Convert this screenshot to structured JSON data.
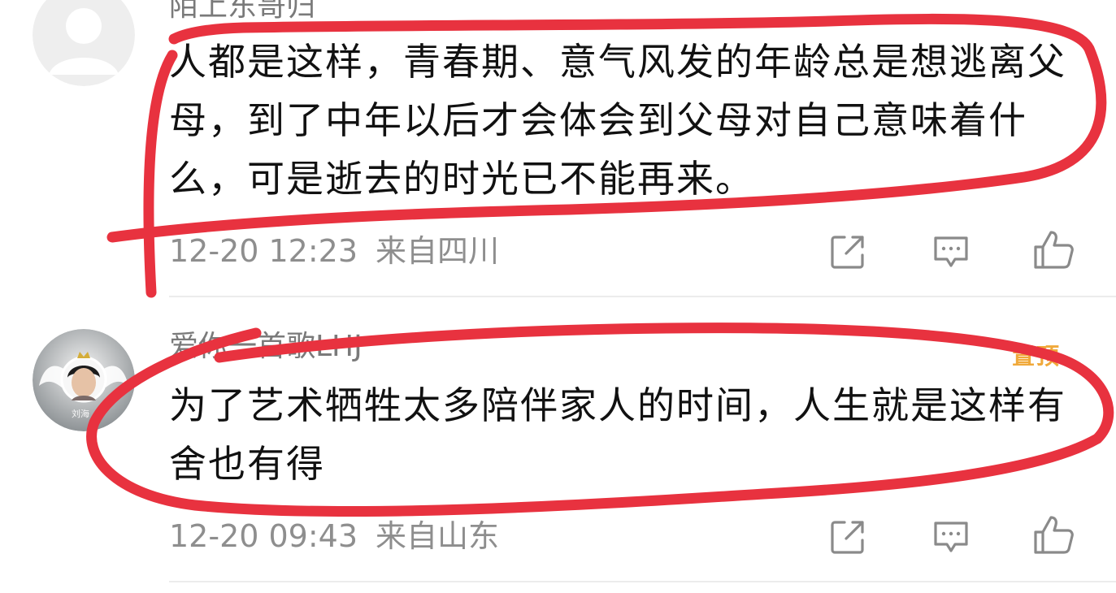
{
  "comments": [
    {
      "username": "陌上东哥归",
      "text": "人都是这样，青春期、意气风发的年龄总是想逃离父母，到了中年以后才会体会到父母对自己意味着什么，可是逝去的时光已不能再来。",
      "time": "12-20 12:23",
      "location": "来自四川",
      "avatar": "default-avatar-icon"
    },
    {
      "username": "爱你一首歌LHJ",
      "badge": "置顶",
      "text": "为了艺术牺牲太多陪伴家人的时间，人生就是这样有舍也有得",
      "time": "12-20 09:43",
      "location": "来自山东",
      "avatar": "photo-avatar-with-wings-icon"
    }
  ],
  "actions": {
    "share_icon": "share-icon",
    "comment_icon": "comment-icon",
    "like_icon": "like-icon"
  },
  "colors": {
    "text": "#111111",
    "meta": "#8e8e8e",
    "username": "#7a7a7a",
    "scribble": "#e8323f",
    "badge": "#f0a93a",
    "divider": "#ececec"
  }
}
